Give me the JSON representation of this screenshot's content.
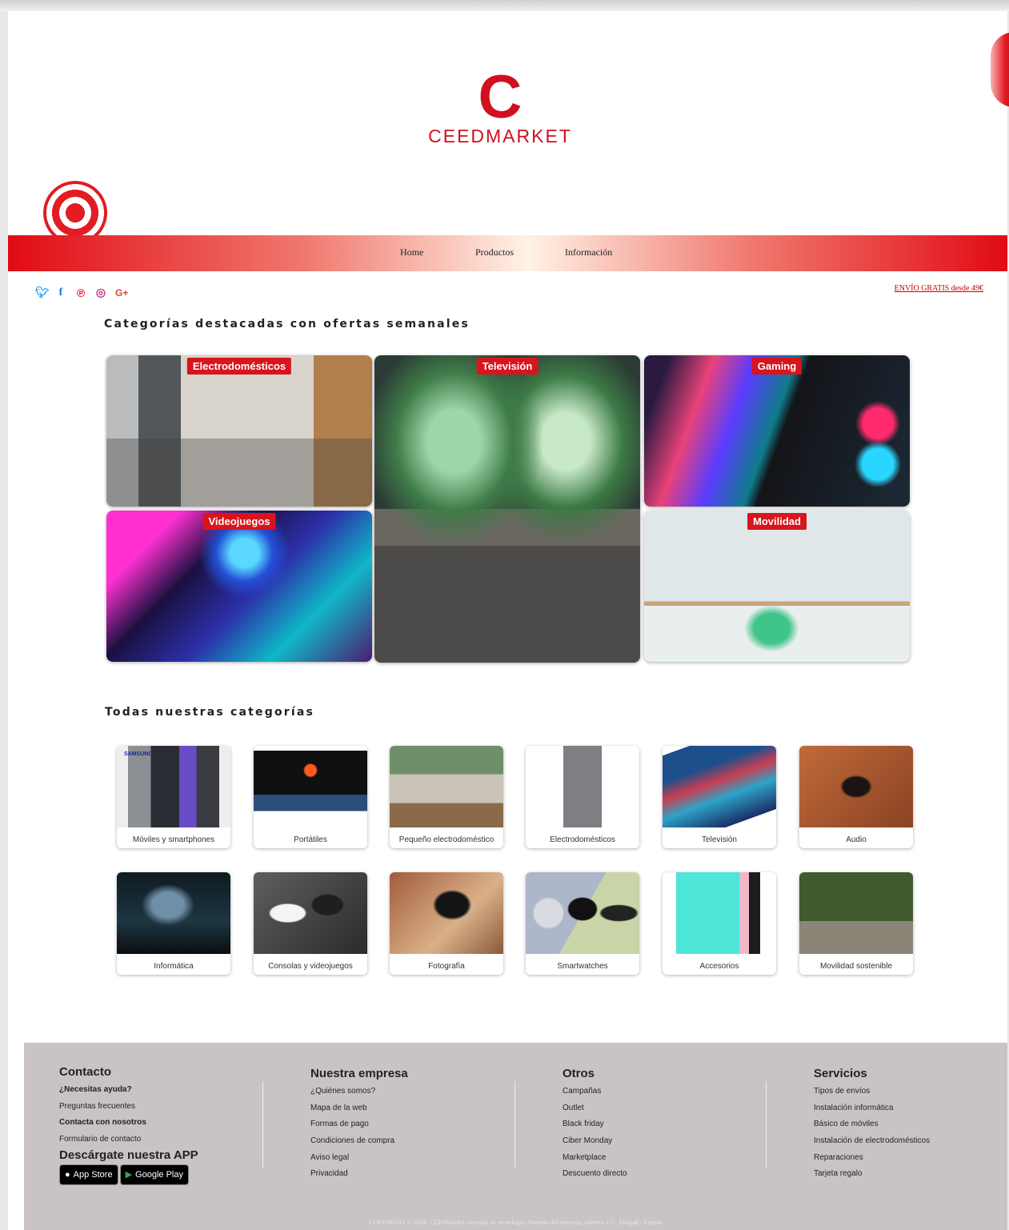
{
  "brand": {
    "initial": "C",
    "name": "CEEDMARKET"
  },
  "nav": {
    "home": "Home",
    "products": "Productos",
    "info": "Información"
  },
  "social": {
    "twitter": "twitter-icon",
    "facebook": "facebook-icon",
    "pinterest": "pinterest-icon",
    "instagram": "instagram-icon",
    "google": "google-plus-icon"
  },
  "shipping": "ENVÍO GRATIS desde 49€",
  "featured": {
    "title": "Categorías destacadas con ofertas semanales",
    "items": [
      "Electrodomésticos",
      "Televisión",
      "Gaming",
      "Videojuegos",
      "Movilidad"
    ]
  },
  "categories": {
    "title": "Todas nuestras categorías",
    "items": [
      "Móviles y smartphones",
      "Portátiles",
      "Pequeño electrodoméstico",
      "Electrodomésticos",
      "Televisión",
      "Audio",
      "Informática",
      "Consolas y videojuegos",
      "Fotografía",
      "Smartwatches",
      "Accesorios",
      "Movilidad sostenible"
    ]
  },
  "card_brand": "SAMSUNG",
  "footer": {
    "contact": {
      "title": "Contacto",
      "help": "¿Necesitas ayuda?",
      "faq": "Preguntas frecuentes",
      "contact_us": "Contacta con nosotros",
      "form": "Formulario de contacto",
      "app_title": "Descárgate nuestra APP",
      "app_store": "App Store",
      "google_play": "Google Play"
    },
    "company": {
      "title": "Nuestra empresa",
      "links": [
        "¿Quiénes somos?",
        "Mapa de la web",
        "Formas de pago",
        "Condiciones de compra",
        "Aviso legal",
        "Privacidad"
      ]
    },
    "others": {
      "title": "Otros",
      "links": [
        "Campañas",
        "Outlet",
        "Black friday",
        "Ciber Monday",
        "Marketplace",
        "Descuento directo"
      ]
    },
    "services": {
      "title": "Servicios",
      "links": [
        "Tipos de envíos",
        "Instalación informática",
        "Básico de móviles",
        "Instalación de electrodomésticos",
        "Reparaciones",
        "Tarjeta regalo"
      ]
    },
    "copyright": "COPYRIGHT © 2024. CEEDMarket mercado de tecnología. Avenida del mercado, número 171, Molgaß - España"
  },
  "colors": {
    "brand_red": "#d10f1e",
    "nav_red": "#e10b14",
    "footer_bg": "#c9c4c3"
  }
}
